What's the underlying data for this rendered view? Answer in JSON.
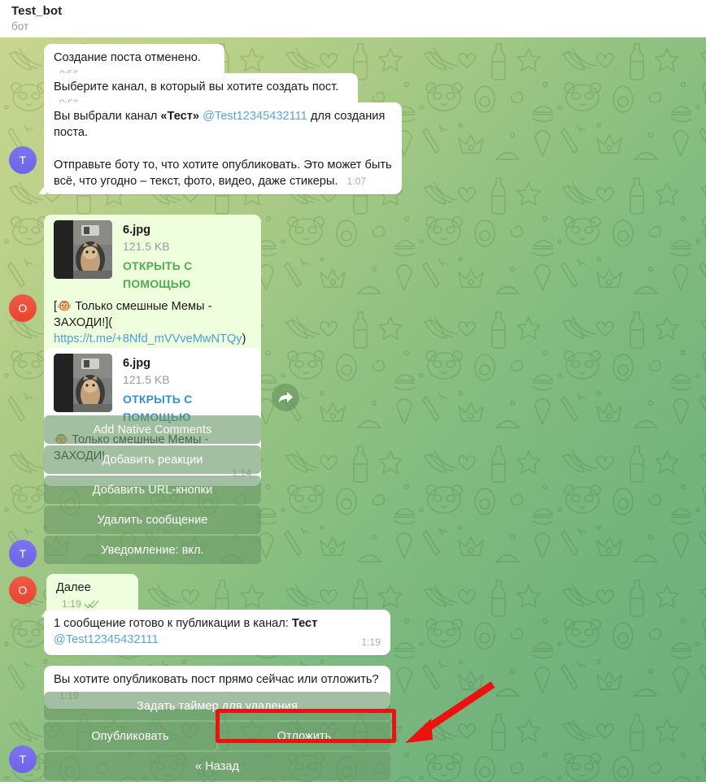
{
  "header": {
    "title": "Test_bot",
    "subtitle": "бот"
  },
  "accent_colors": {
    "incoming_bubble": "#ffffff",
    "outgoing_bubble": "#effedd",
    "link": "#4c9fd4",
    "mention": "#57a7d8",
    "keyboard_button": "#6a9868",
    "highlight": "#ee1111",
    "avatar_purple": "#6e64e8",
    "avatar_red": "#e8452f",
    "tick_green": "#64b05e"
  },
  "avatars": [
    {
      "letter": "T",
      "color": "purple"
    },
    {
      "letter": "O",
      "color": "red"
    },
    {
      "letter": "T",
      "color": "purple"
    },
    {
      "letter": "O",
      "color": "red"
    },
    {
      "letter": "T",
      "color": "purple"
    }
  ],
  "messages": [
    {
      "id": "m1",
      "direction": "in",
      "text": "Создание поста отменено.",
      "time": "0:56"
    },
    {
      "id": "m2",
      "direction": "in",
      "text": "Выберите канал, в который вы хотите создать пост.",
      "time": "0:56"
    },
    {
      "id": "m3",
      "direction": "in",
      "line1_pre": "Вы выбрали канал ",
      "line1_bold": "«Тест»",
      "line1_mention": "@Test12345432111",
      "line1_post": " для создания поста.",
      "line2": "Отправьте боту то, что хотите опубликовать. Это может быть всё, что угодно – текст, фото, видео, даже стикеры.",
      "time": "1:07"
    },
    {
      "id": "m4",
      "direction": "out",
      "file_name": "6.jpg",
      "file_size": "121.5 KB",
      "file_action": "ОТКРЫТЬ С ПОМОЩЬЮ",
      "file_action_color": "green",
      "caption_pre": "[",
      "caption_emoji": "🐵",
      "caption_mid": " Только смешные Мемы - ЗАХОДИ!](",
      "caption_link": "https://t.me/+8Nfd_mVVveMwNTQy",
      "caption_post": ")",
      "time": "1:14",
      "ticks": true
    },
    {
      "id": "m5",
      "direction": "in",
      "file_name": "6.jpg",
      "file_size": "121.5 KB",
      "file_action": "ОТКРЫТЬ С ПОМОЩЬЮ",
      "file_action_color": "blue",
      "caption_emoji": "🐵",
      "caption_text": " Только смешные Мемы - ЗАХОДИ!",
      "time": "1:14",
      "forward_button": "forward-icon"
    },
    {
      "id": "m6",
      "direction": "out",
      "text": "Далее",
      "time": "1:19",
      "ticks": true
    },
    {
      "id": "m7",
      "direction": "in",
      "line1_pre": "1 сообщение готово к публикации в канал: ",
      "line1_bold": "Тест",
      "line2_mention": "@Test12345432111",
      "time": "1:19"
    },
    {
      "id": "m8",
      "direction": "in",
      "text": "Вы хотите опубликовать пост прямо сейчас или отложить?",
      "time": "1:19"
    }
  ],
  "keyboard_1": {
    "rows": [
      [
        {
          "label": "Add Native Comments"
        }
      ],
      [
        {
          "label": "Добавить реакции"
        }
      ],
      [
        {
          "label": "Добавить URL-кнопки"
        }
      ],
      [
        {
          "label": "Удалить сообщение"
        }
      ],
      [
        {
          "label": "Уведомление: вкл."
        }
      ]
    ]
  },
  "keyboard_2": {
    "rows": [
      [
        {
          "label": "Задать таймер для удаления"
        }
      ],
      [
        {
          "label": "Опубликовать"
        },
        {
          "label": "Отложить",
          "highlighted": true
        }
      ],
      [
        {
          "label": "« Назад"
        }
      ]
    ]
  },
  "annotation": {
    "type": "arrow",
    "color": "#ee1111",
    "points_to": "Отложить"
  }
}
